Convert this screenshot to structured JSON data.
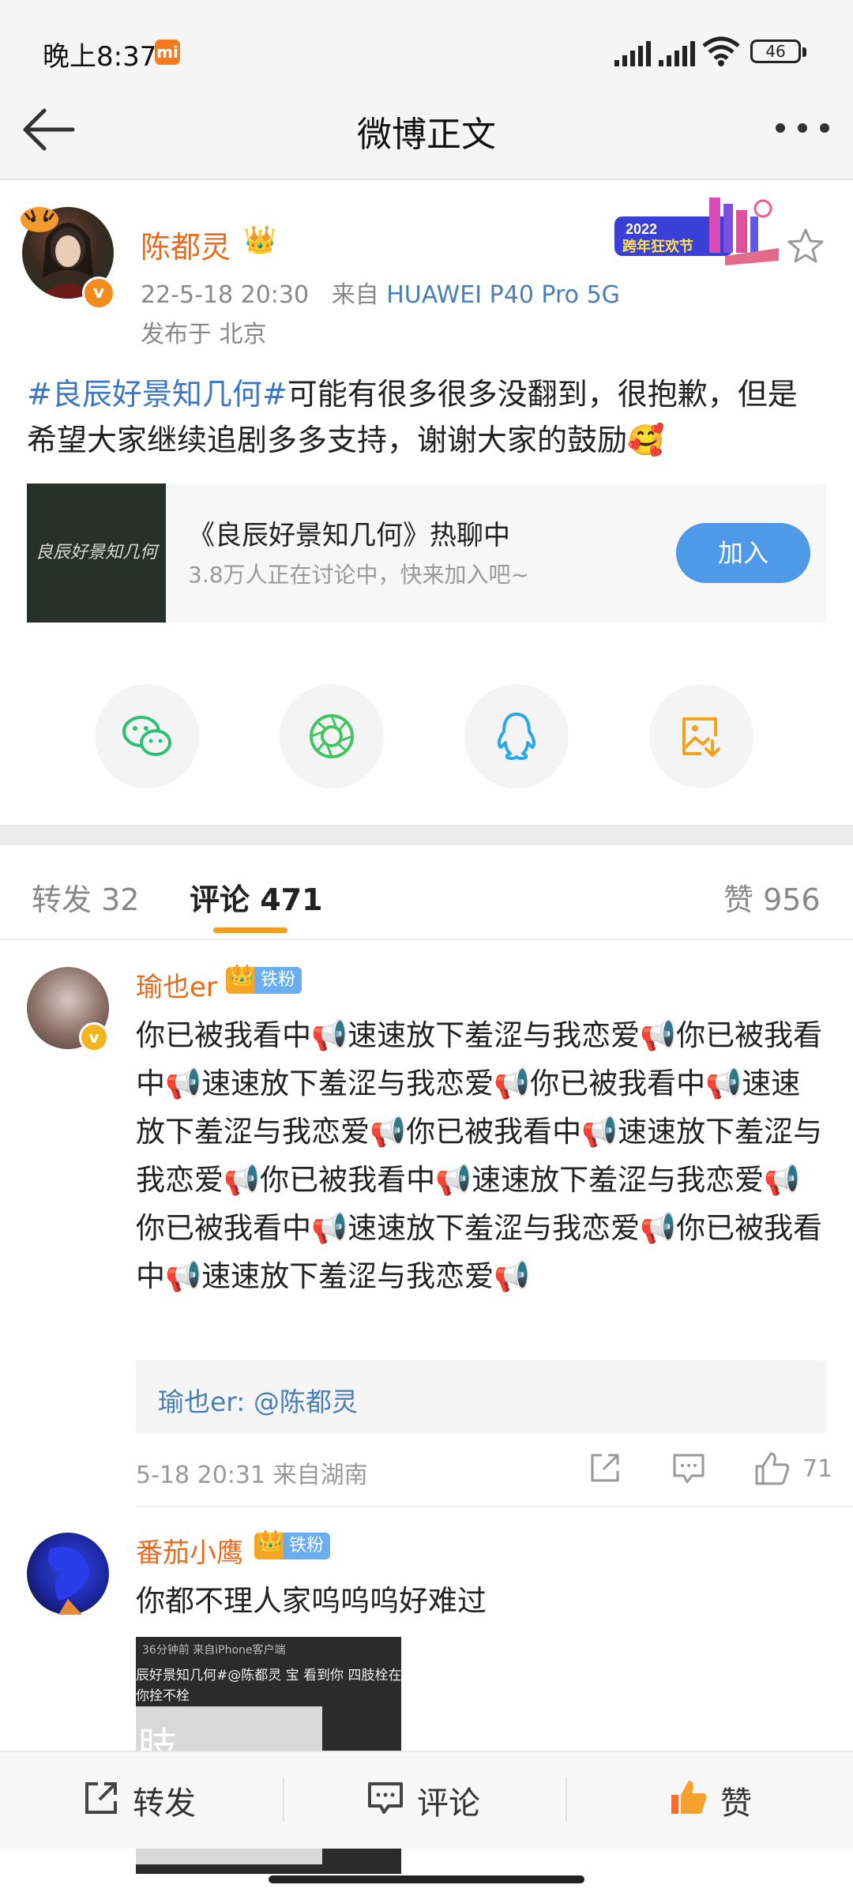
{
  "status_bar": {
    "time": "晚上8:37",
    "mi_badge": "mi",
    "battery": "46"
  },
  "header": {
    "title": "微博正文"
  },
  "post": {
    "author": "陈都灵",
    "time": "22-5-18 20:30",
    "from_prefix": "来自",
    "device": "HUAWEI P40 Pro 5G",
    "location": "发布于 北京",
    "hashtag": "#良辰好景知几何#",
    "text": "可能有很多很多没翻到，很抱歉，但是希望大家继续追剧多多支持，谢谢大家的鼓励🥰",
    "festival_badge": "2022 跨年狂欢节"
  },
  "topic_card": {
    "thumb_text": "良辰好景知几何",
    "title": "《良辰好景知几何》热聊中",
    "subtitle": "3.8万人正在讨论中，快来加入吧~",
    "join_label": "加入"
  },
  "share_icons": [
    "wechat-icon",
    "moments-icon",
    "qq-icon",
    "save-image-icon"
  ],
  "tabs": {
    "repost": "转发 32",
    "comments": "评论 471",
    "likes": "赞 956"
  },
  "comments": [
    {
      "name": "瑜也er",
      "fan_badge": "铁粉",
      "text": "你已被我看中📢速速放下羞涩与我恋爱📢你已被我看中📢速速放下羞涩与我恋爱📢你已被我看中📢速速放下羞涩与我恋爱📢你已被我看中📢速速放下羞涩与我恋爱📢你已被我看中📢速速放下羞涩与我恋爱📢你已被我看中📢速速放下羞涩与我恋爱📢你已被我看中📢速速放下羞涩与我恋爱📢",
      "reply_name": "瑜也er",
      "reply_text": ": @陈都灵",
      "meta": "5-18 20:31 来自湖南",
      "likes": "71"
    },
    {
      "name": "番茄小鹰",
      "fan_badge": "铁粉",
      "text": "你都不理人家呜呜呜好难过",
      "screenshot": {
        "line1": "36分钟前 来自iPhone客户端",
        "line2": "辰好景知几何#@陈都灵 宝 看到你 四肢栓在",
        "line3": "你拴不栓",
        "big_char": "肢"
      }
    }
  ],
  "bottom_bar": {
    "repost": "转发",
    "comment": "评论",
    "like": "赞"
  },
  "colors": {
    "accent_orange": "#f39c1f",
    "link_blue": "#4a7fb5",
    "join_blue": "#4e9ae8",
    "name_orange": "#e86a1a"
  }
}
